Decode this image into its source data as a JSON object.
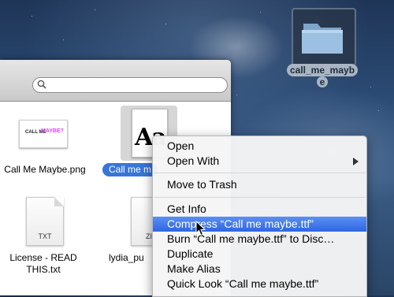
{
  "desktop": {
    "folder_label_line1": "call_me_mayb",
    "folder_label_line2": "e",
    "folder_icon": "folder-icon"
  },
  "finder": {
    "search": {
      "placeholder": "",
      "icon": "search-icon"
    },
    "files": [
      {
        "label": "Call Me Maybe.png",
        "thumb_text_1": "CALL ME",
        "thumb_text_2": "MAYBE?"
      },
      {
        "label": "Call me maybe.ttf",
        "label_visible": "Call me m",
        "selected": true,
        "thumb_text": "Aa"
      },
      {
        "label_line1": "License - READ",
        "label_line2": "THIS.txt",
        "ext": "TXT"
      },
      {
        "label": "lydia_pu",
        "ext": "ZI"
      }
    ]
  },
  "context_menu": {
    "items": [
      {
        "label": "Open"
      },
      {
        "label": "Open With",
        "submenu": true
      },
      {
        "label": "Move to Trash"
      },
      {
        "label": "Get Info"
      },
      {
        "label": "Compress “Call me maybe.ttf”",
        "highlighted": true
      },
      {
        "label": "Burn “Call me maybe.ttf” to Disc…"
      },
      {
        "label": "Duplicate"
      },
      {
        "label": "Make Alias"
      },
      {
        "label": "Quick Look “Call me maybe.ttf”"
      }
    ]
  }
}
